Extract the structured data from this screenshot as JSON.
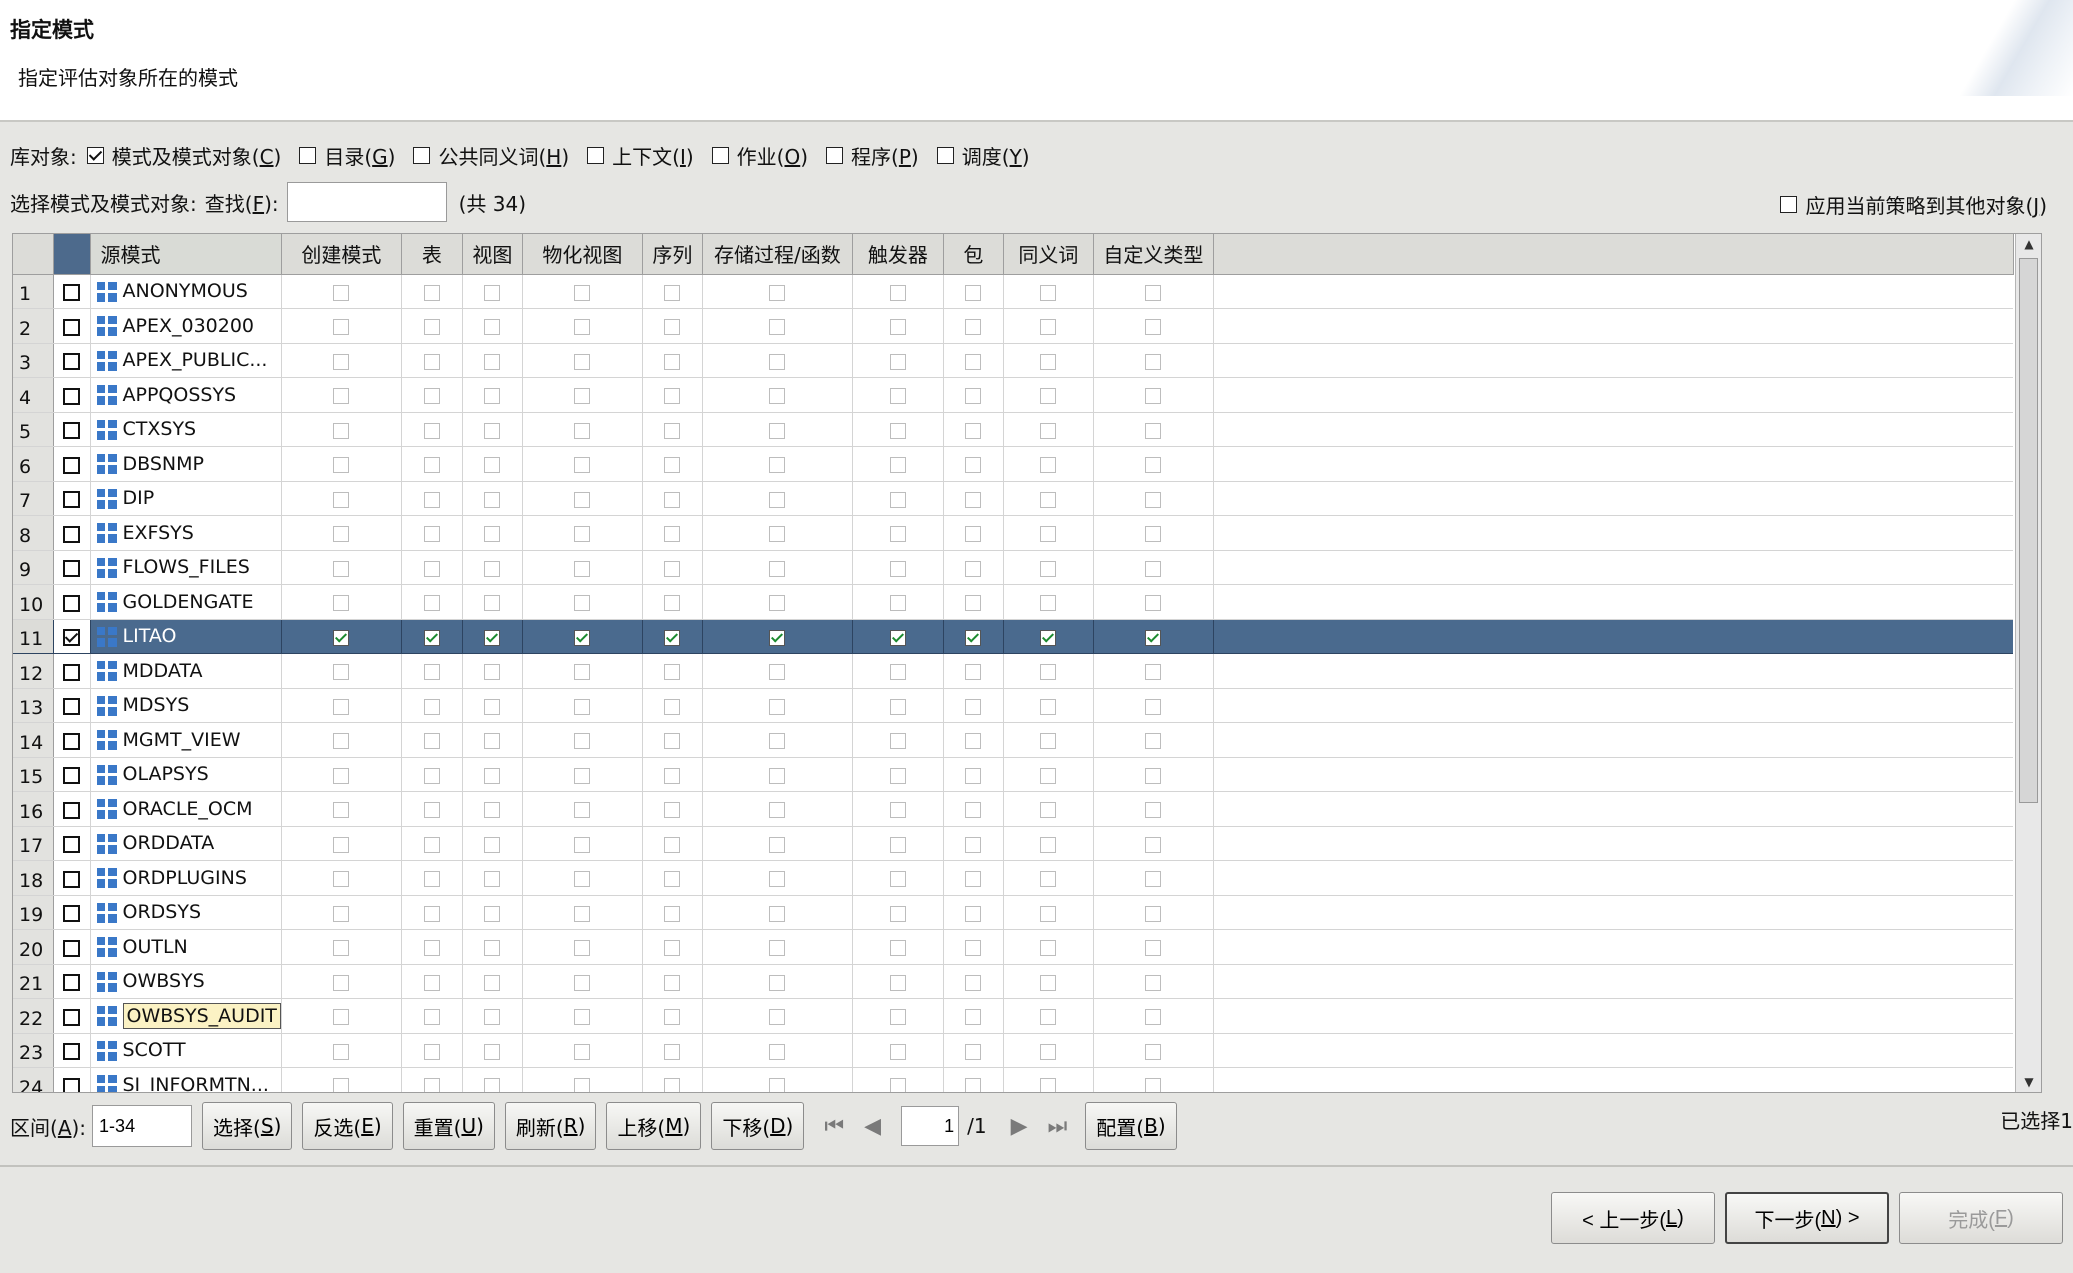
{
  "header": {
    "title": "指定模式",
    "subtitle": "指定评估对象所在的模式"
  },
  "library_objects": {
    "label": "库对象:",
    "options": [
      {
        "text": "模式及模式对象(",
        "key": "C",
        "after": ")",
        "checked": true
      },
      {
        "text": "目录(",
        "key": "G",
        "after": ")",
        "checked": false
      },
      {
        "text": "公共同义词(",
        "key": "H",
        "after": ")",
        "checked": false
      },
      {
        "text": "上下文(",
        "key": "I",
        "after": ")",
        "checked": false
      },
      {
        "text": "作业(",
        "key": "O",
        "after": ")",
        "checked": false
      },
      {
        "text": "程序(",
        "key": "P",
        "after": ")",
        "checked": false
      },
      {
        "text": "调度(",
        "key": "Y",
        "after": ")",
        "checked": false
      }
    ]
  },
  "select_row": {
    "label": "选择模式及模式对象:",
    "find_label": "查找(",
    "find_key": "F",
    "find_after": "):",
    "find_value": "",
    "total": "(共 34)",
    "apply_other_label": "应用当前策略到其他对象(",
    "apply_other_key": "J",
    "apply_other_after": ")",
    "apply_other_checked": false
  },
  "table": {
    "columns": [
      "源模式",
      "创建模式",
      "表",
      "视图",
      "物化视图",
      "序列",
      "存储过程/函数",
      "触发器",
      "包",
      "同义词",
      "自定义类型"
    ],
    "rows": [
      {
        "num": "1",
        "name": "ANONYMOUS",
        "selected": false
      },
      {
        "num": "2",
        "name": "APEX_030200",
        "selected": false
      },
      {
        "num": "3",
        "name": "APEX_PUBLIC...",
        "selected": false
      },
      {
        "num": "4",
        "name": "APPQOSSYS",
        "selected": false
      },
      {
        "num": "5",
        "name": "CTXSYS",
        "selected": false
      },
      {
        "num": "6",
        "name": "DBSNMP",
        "selected": false
      },
      {
        "num": "7",
        "name": "DIP",
        "selected": false
      },
      {
        "num": "8",
        "name": "EXFSYS",
        "selected": false
      },
      {
        "num": "9",
        "name": "FLOWS_FILES",
        "selected": false
      },
      {
        "num": "10",
        "name": "GOLDENGATE",
        "selected": false
      },
      {
        "num": "11",
        "name": "LITAO",
        "selected": true
      },
      {
        "num": "12",
        "name": "MDDATA",
        "selected": false
      },
      {
        "num": "13",
        "name": "MDSYS",
        "selected": false
      },
      {
        "num": "14",
        "name": "MGMT_VIEW",
        "selected": false
      },
      {
        "num": "15",
        "name": "OLAPSYS",
        "selected": false
      },
      {
        "num": "16",
        "name": "ORACLE_OCM",
        "selected": false
      },
      {
        "num": "17",
        "name": "ORDDATA",
        "selected": false
      },
      {
        "num": "18",
        "name": "ORDPLUGINS",
        "selected": false
      },
      {
        "num": "19",
        "name": "ORDSYS",
        "selected": false
      },
      {
        "num": "20",
        "name": "OUTLN",
        "selected": false
      },
      {
        "num": "21",
        "name": "OWBSYS",
        "selected": false
      },
      {
        "num": "22",
        "name": "OWBSYS_AUDIT",
        "selected": false,
        "tooltip": true
      },
      {
        "num": "23",
        "name": "SCOTT",
        "selected": false
      },
      {
        "num": "24",
        "name": "SI_INFORMTN...",
        "selected": false
      }
    ]
  },
  "toolbar": {
    "range_label": "区间(",
    "range_key": "A",
    "range_after": "):",
    "range_value": "1-34",
    "buttons": [
      {
        "text": "选择(",
        "key": "S",
        "after": ")"
      },
      {
        "text": "反选(",
        "key": "E",
        "after": ")"
      },
      {
        "text": "重置(",
        "key": "U",
        "after": ")"
      },
      {
        "text": "刷新(",
        "key": "R",
        "after": ")"
      },
      {
        "text": "上移(",
        "key": "M",
        "after": ")"
      },
      {
        "text": "下移(",
        "key": "D",
        "after": ")"
      }
    ],
    "page_value": "1",
    "page_total": "/1",
    "config": {
      "text": "配置(",
      "key": "B",
      "after": ")"
    },
    "selected_count": "已选择1"
  },
  "wizard": {
    "prev": {
      "text": "< 上一步(",
      "key": "L",
      "after": ")"
    },
    "next": {
      "text": "下一步(",
      "key": "N",
      "after": ") >"
    },
    "finish": {
      "text": "完成(",
      "key": "F",
      "after": ")"
    }
  },
  "colors": {
    "selected_row": "#4a6a8e",
    "check_green": "#1c8a2e",
    "schema_icon": "#3a78c8"
  }
}
